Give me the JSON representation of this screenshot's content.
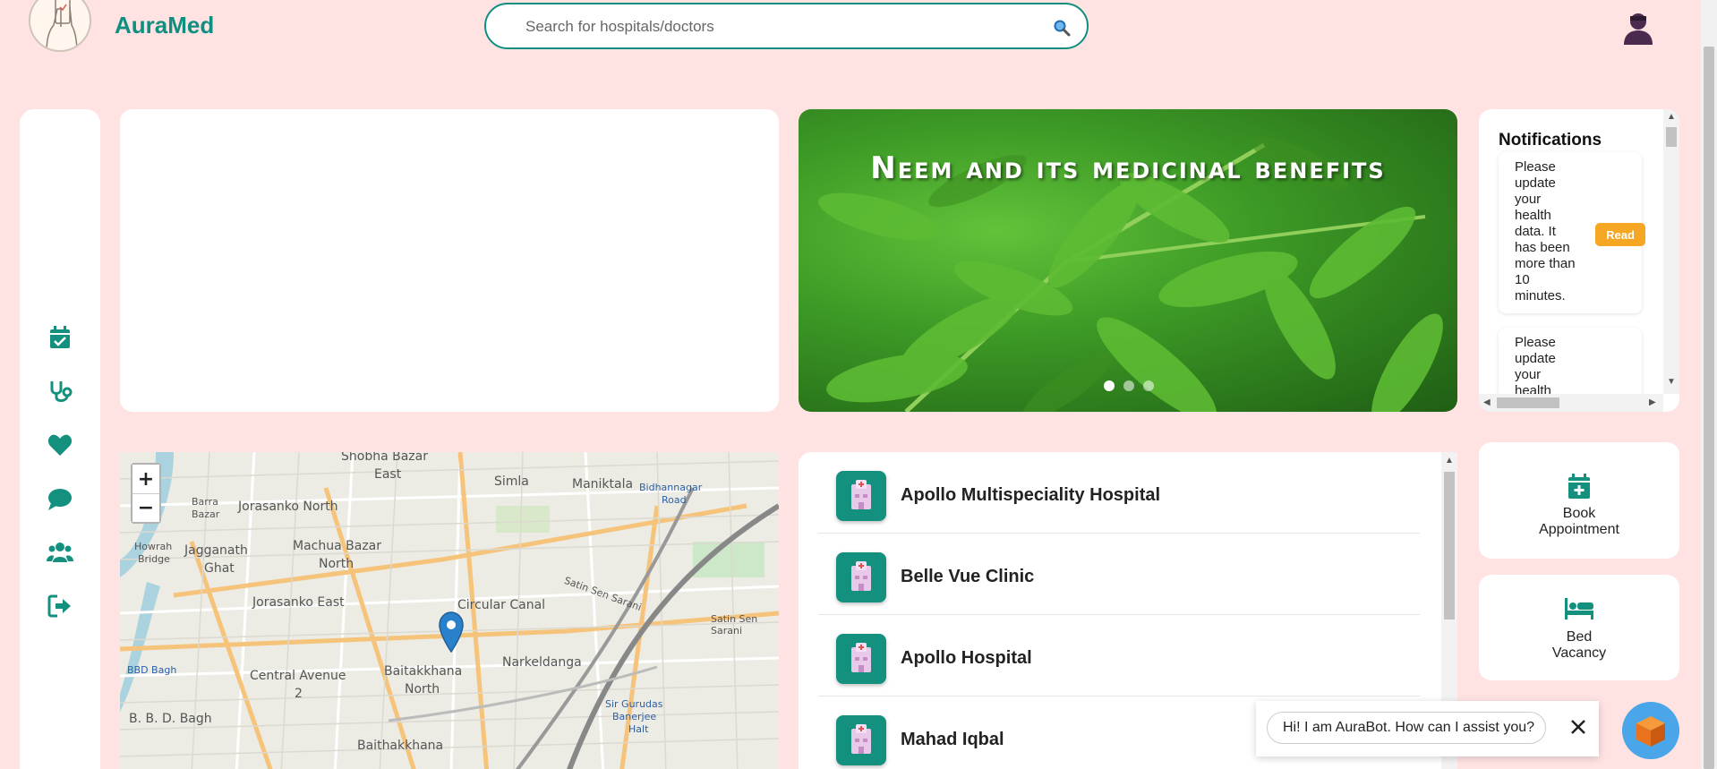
{
  "brand": {
    "name": "AuraMed"
  },
  "search": {
    "placeholder": "Search for hospitals/doctors"
  },
  "carousel": {
    "title": "Neem and its medicinal benefits",
    "active_slide": 1,
    "slide_count": 3
  },
  "notifications": {
    "title": "Notifications",
    "items": [
      {
        "text": "Please update your health data. It has been more than 10 minutes.",
        "action": "Read"
      },
      {
        "text": "Please update your health",
        "action": ""
      }
    ]
  },
  "map": {
    "zoom_in": "+",
    "zoom_out": "−",
    "labels": [
      "Shobha Bazar",
      "East",
      "Jorasanko North",
      "Barra",
      "Bazar",
      "Simla",
      "Maniktala",
      "Bidhannagar",
      "Road",
      "Machua Bazar",
      "North",
      "Howrah",
      "Bridge",
      "Jagganath",
      "Ghat",
      "Jorasanko East",
      "Circular Canal",
      "Satin Sen Sarani",
      "Satin Sen Sarani",
      "BBD Bagh",
      "Central Avenue",
      "2",
      "Baitakkhana",
      "North",
      "Narkeldanga",
      "B. B. D. Bagh",
      "Sir Gurudas",
      "Banerjee",
      "Halt",
      "Baithakkhana"
    ]
  },
  "hospitals": [
    {
      "name": "Apollo Multispeciality Hospital"
    },
    {
      "name": "Belle Vue Clinic"
    },
    {
      "name": "Apollo Hospital"
    },
    {
      "name": "Mahad Iqbal"
    }
  ],
  "actions": {
    "book": {
      "line1": "Book",
      "line2": "Appointment"
    },
    "bed": {
      "line1": "Bed",
      "line2": "Vacancy"
    }
  },
  "chatbot": {
    "message": "Hi! I am AuraBot. How can I assist you?"
  },
  "colors": {
    "background": "#ffe3e3",
    "brand": "#0f8f80",
    "read_button": "#f5a623",
    "fab": "#4aa6e8"
  }
}
